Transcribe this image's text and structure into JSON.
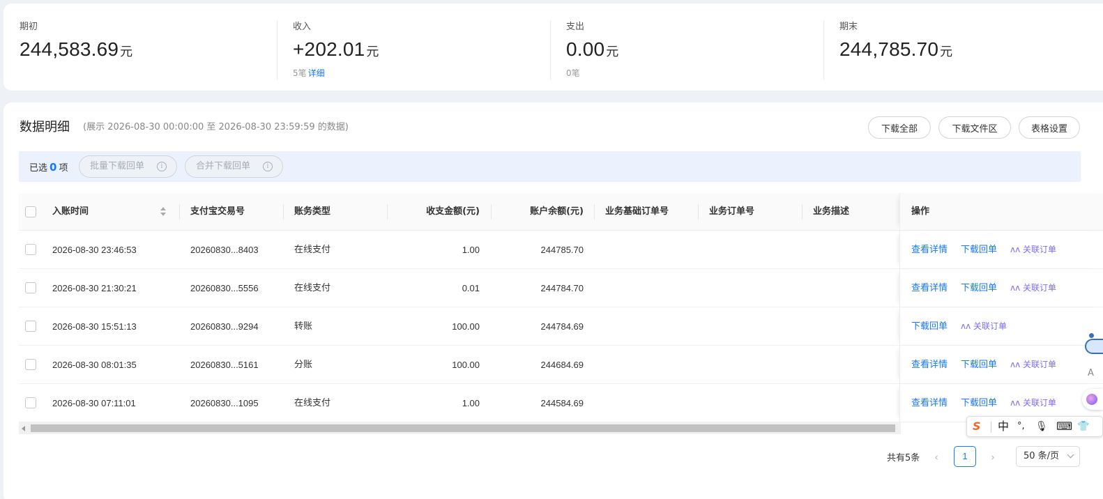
{
  "summary": [
    {
      "label": "期初",
      "value": "244,583.69",
      "unit": "元",
      "sub_count": "",
      "sub_link": ""
    },
    {
      "label": "收入",
      "value": "+202.01",
      "unit": "元",
      "sub_count": "5笔",
      "sub_link": "详细"
    },
    {
      "label": "支出",
      "value": "0.00",
      "unit": "元",
      "sub_count": "0笔",
      "sub_link": ""
    },
    {
      "label": "期末",
      "value": "244,785.70",
      "unit": "元",
      "sub_count": "",
      "sub_link": ""
    }
  ],
  "detail": {
    "title": "数据明细",
    "range": "(展示 2026-08-30 00:00:00 至 2026-08-30 23:59:59 的数据)",
    "buttons": {
      "download_all": "下载全部",
      "download_files": "下载文件区",
      "table_settings": "表格设置"
    }
  },
  "selection": {
    "prefix": "已选",
    "count": "0",
    "suffix": "项",
    "batch_download": "批量下载回单",
    "merge_download": "合并下载回单"
  },
  "table": {
    "columns": {
      "time": "入账时间",
      "trade_no": "支付宝交易号",
      "type": "账务类型",
      "amount": "收支金额(元)",
      "balance": "账户余额(元)",
      "base_order": "业务基础订单号",
      "order": "业务订单号",
      "desc": "业务描述",
      "ops": "操作"
    },
    "rows": [
      {
        "time": "2026-08-30 23:46:53",
        "trade_no": "20260830...8403",
        "type": "在线支付",
        "amount": "1.00",
        "balance": "244785.70",
        "op1": "查看详情",
        "op2": "下载回单",
        "op3": "关联订单"
      },
      {
        "time": "2026-08-30 21:30:21",
        "trade_no": "20260830...5556",
        "type": "在线支付",
        "amount": "0.01",
        "balance": "244784.70",
        "op1": "查看详情",
        "op2": "下载回单",
        "op3": "关联订单"
      },
      {
        "time": "2026-08-30 15:51:13",
        "trade_no": "20260830...9294",
        "type": "转账",
        "amount": "100.00",
        "balance": "244784.69",
        "op1": "下载回单",
        "op2": "关联订单",
        "op3": ""
      },
      {
        "time": "2026-08-30 08:01:35",
        "trade_no": "20260830...5161",
        "type": "分账",
        "amount": "100.00",
        "balance": "244684.69",
        "op1": "查看详情",
        "op2": "下载回单",
        "op3": "关联订单"
      },
      {
        "time": "2026-08-30 07:11:01",
        "trade_no": "20260830...1095",
        "type": "在线支付",
        "amount": "1.00",
        "balance": "244584.69",
        "op1": "查看详情",
        "op2": "下载回单",
        "op3": "关联订单"
      }
    ]
  },
  "pagination": {
    "total": "共有5条",
    "current": "1",
    "page_size": "50 条/页",
    "prev": "‹",
    "next": "›"
  },
  "ime": {
    "lang": "中",
    "punct": "°,",
    "mic": "🎙",
    "keyboard": "⌨",
    "skin": "👕"
  },
  "side": {
    "letter": "A"
  },
  "colors": {
    "accent": "#1677ff",
    "relate": "#7b6cf6",
    "selbar": "#ebf2fd"
  }
}
